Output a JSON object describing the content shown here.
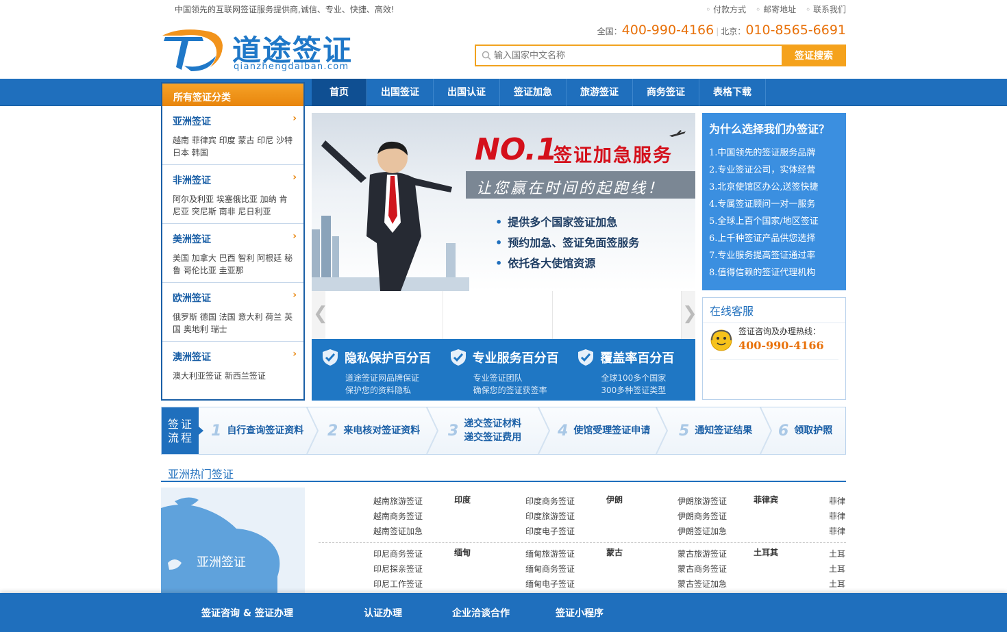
{
  "topbar": {
    "slogan": "中国领先的互联网签证服务提供商,诚信、专业、快捷、高效!",
    "links": [
      "付款方式",
      "邮寄地址",
      "联系我们"
    ]
  },
  "header": {
    "logo_name": "道途签证",
    "logo_domain": "qianzhengdaiban.com",
    "hotline_nation_label": "全国：",
    "hotline_nation": "400-990-4166",
    "hotline_beijing_label": "北京：",
    "hotline_beijing": "010-8565-6691",
    "search_placeholder": "输入国家中文名称",
    "search_button": "签证搜索"
  },
  "nav": {
    "category_title": "所有签证分类",
    "items": [
      "首页",
      "出国签证",
      "出国认证",
      "签证加急",
      "旅游签证",
      "商务签证",
      "表格下载"
    ]
  },
  "categories": [
    {
      "title": "亚洲签证",
      "countries": "越南 菲律宾 印度 蒙古 印尼 沙特 日本 韩国"
    },
    {
      "title": "非洲签证",
      "countries": "阿尔及利亚 埃塞俄比亚 加纳 肯尼亚 突尼斯 南非 尼日利亚"
    },
    {
      "title": "美洲签证",
      "countries": "美国 加拿大 巴西 智利 阿根廷 秘鲁 哥伦比亚 圭亚那"
    },
    {
      "title": "欧洲签证",
      "countries": "俄罗斯 德国 法国 意大利 荷兰 英国 奥地利 瑞士"
    },
    {
      "title": "澳洲签证",
      "countries": "澳大利亚签证 新西兰签证"
    }
  ],
  "banner": {
    "no1": "NO.1",
    "service": "签证加急服务",
    "slogan": "让您赢在时间的起跑线！",
    "points": [
      "提供多个国家签证加急",
      "预约加急、签证免面签服务",
      "依托各大使馆资源"
    ]
  },
  "promo": [
    {
      "title": "隐私保护百分百",
      "line1": "道途签证网品牌保证",
      "line2": "保护您的资料隐私"
    },
    {
      "title": "专业服务百分百",
      "line1": "专业签证团队",
      "line2": "确保您的签证获签率"
    },
    {
      "title": "覆盖率百分百",
      "line1": "全球100多个国家",
      "line2": "300多种签证类型"
    }
  ],
  "why": {
    "title": "为什么选择我们办签证？",
    "items": [
      "1.中国领先的签证服务品牌",
      "2.专业签证公司，实体经营",
      "3.北京使馆区办公,送签快捷",
      "4.专属签证顾问一对一服务",
      "5.全球上百个国家/地区签证",
      "6.上千种签证产品供您选择",
      "7.专业服务提高签证通过率",
      "8.值得信赖的签证代理机构"
    ]
  },
  "online": {
    "title": "在线客服",
    "label": "签证咨询及办理热线：",
    "number": "400-990-4166"
  },
  "process": {
    "label_line1": "签证",
    "label_line2": "流程",
    "steps": [
      {
        "num": "1",
        "text": "自行查询签证资料"
      },
      {
        "num": "2",
        "text": "来电核对签证资料"
      },
      {
        "num": "3",
        "text": "递交签证材料",
        "text2": "递交签证费用"
      },
      {
        "num": "4",
        "text": "使馆受理签证申请"
      },
      {
        "num": "5",
        "text": "通知签证结果"
      },
      {
        "num": "6",
        "text": "领取护照"
      }
    ]
  },
  "hot": {
    "title": "亚洲热门签证",
    "map_label": "亚洲签证",
    "rows": [
      [
        {
          "name": "越南",
          "links": [
            "越南旅游签证",
            "越南商务签证",
            "越南签证加急"
          ]
        },
        {
          "name": "印度",
          "links": [
            "印度商务签证",
            "印度旅游签证",
            "印度电子签证"
          ]
        },
        {
          "name": "伊朗",
          "links": [
            "伊朗旅游签证",
            "伊朗商务签证",
            "伊朗签证加急"
          ]
        },
        {
          "name": "菲律宾",
          "links": [
            "菲律",
            "菲律",
            "菲律"
          ]
        }
      ],
      [
        {
          "name": "印尼",
          "links": [
            "印尼商务签证",
            "印尼探亲签证",
            "印尼工作签证"
          ]
        },
        {
          "name": "缅甸",
          "links": [
            "缅甸旅游签证",
            "缅甸商务签证",
            "缅甸电子签证"
          ]
        },
        {
          "name": "蒙古",
          "links": [
            "蒙古旅游签证",
            "蒙古商务签证",
            "蒙古签证加急"
          ]
        },
        {
          "name": "土耳其",
          "links": [
            "土耳",
            "土耳",
            "土耳"
          ]
        }
      ]
    ]
  },
  "footer": {
    "items": [
      "签证咨询 & 签证办理",
      "认证办理",
      "企业洽谈合作",
      "签证小程序"
    ]
  },
  "colors": {
    "brand_blue": "#1f6fbd",
    "accent_orange": "#f5a21c",
    "hotline_orange": "#e8710a",
    "banner_red": "#d4101b"
  }
}
